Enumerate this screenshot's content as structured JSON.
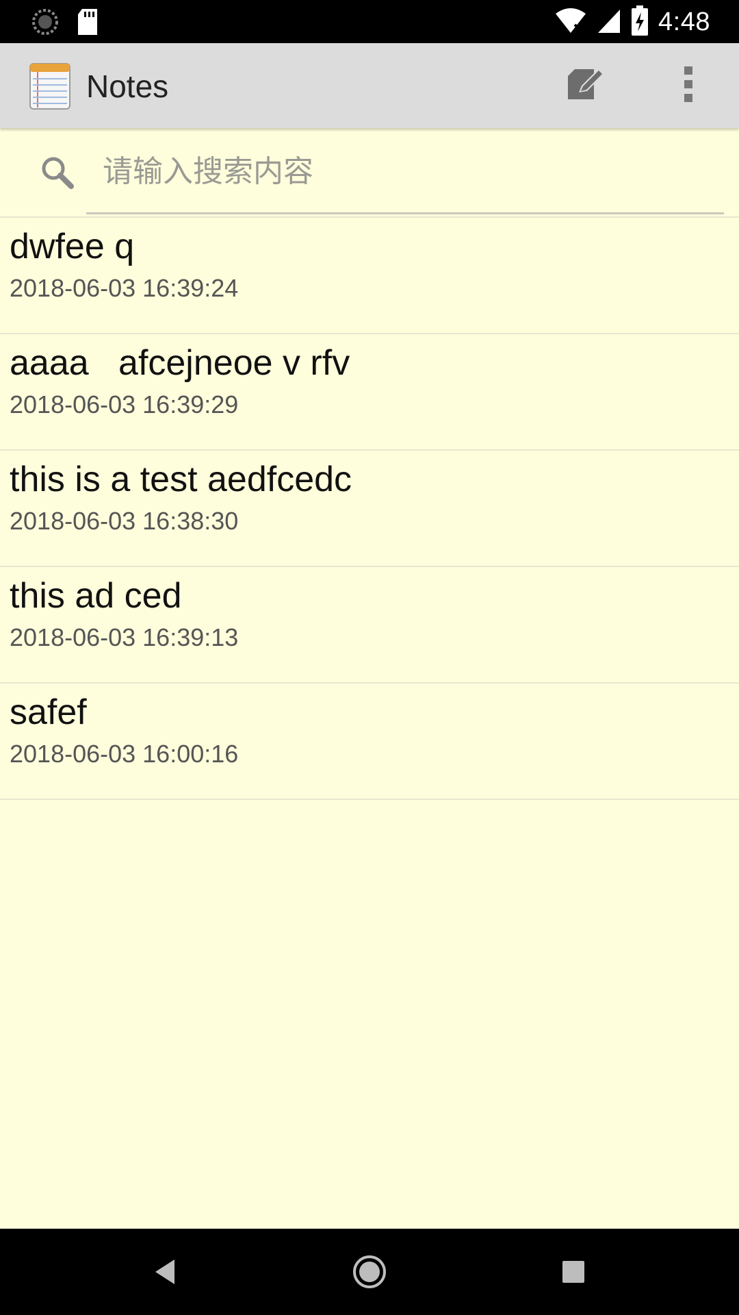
{
  "status_bar": {
    "time": "4:48",
    "left_icons": [
      "loading-icon",
      "sd-card-icon"
    ],
    "right_icons": [
      "wifi-icon",
      "signal-icon",
      "battery-charging-icon"
    ]
  },
  "app_bar": {
    "title": "Notes",
    "app_icon": "notepad-icon",
    "actions": [
      "compose-icon",
      "overflow-menu-icon"
    ]
  },
  "search": {
    "placeholder": "请输入搜索内容",
    "value": ""
  },
  "notes": [
    {
      "title": "dwfee q",
      "date": "2018-06-03 16:39:24"
    },
    {
      "title": "aaaa   afcejneoe v rfv",
      "date": "2018-06-03 16:39:29"
    },
    {
      "title": "this is a test aedfcedc",
      "date": "2018-06-03 16:38:30"
    },
    {
      "title": "this ad ced",
      "date": "2018-06-03 16:39:13"
    },
    {
      "title": "safef",
      "date": "2018-06-03 16:00:16"
    }
  ],
  "nav_bar": {
    "buttons": [
      "back-icon",
      "home-icon",
      "recents-icon"
    ]
  },
  "colors": {
    "background": "#fefedc",
    "app_bar": "#dcdcdc",
    "status_bar": "#000000",
    "divider": "#e7e7d2"
  }
}
